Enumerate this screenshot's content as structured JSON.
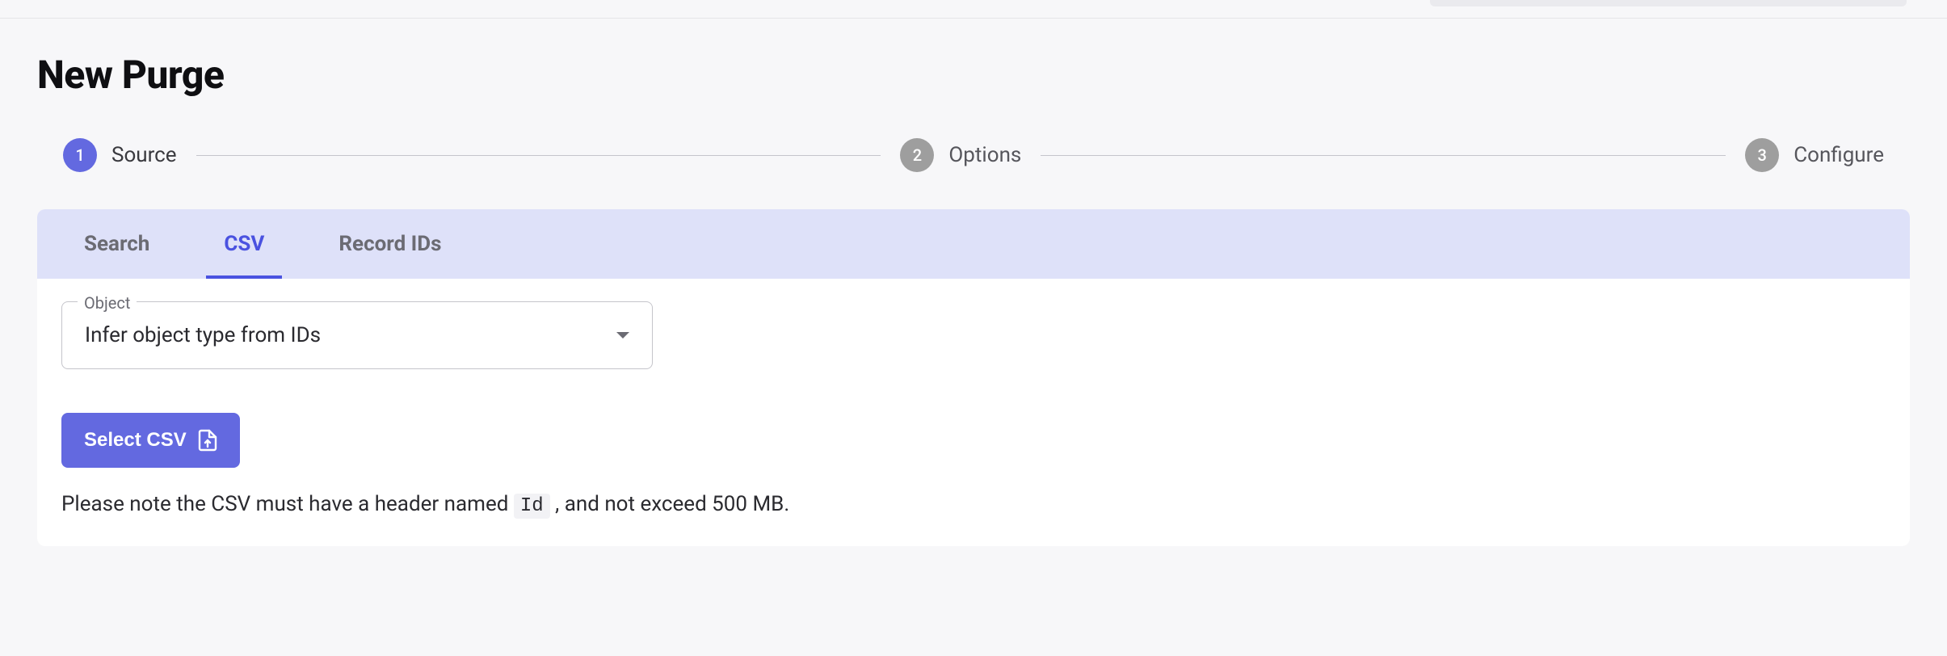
{
  "page": {
    "title": "New Purge"
  },
  "stepper": {
    "steps": [
      {
        "num": "1",
        "label": "Source",
        "active": true
      },
      {
        "num": "2",
        "label": "Options",
        "active": false
      },
      {
        "num": "3",
        "label": "Configure",
        "active": false
      }
    ]
  },
  "tabs": [
    {
      "label": "Search",
      "active": false
    },
    {
      "label": "CSV",
      "active": true
    },
    {
      "label": "Record IDs",
      "active": false
    }
  ],
  "object_select": {
    "label": "Object",
    "value": "Infer object type from IDs"
  },
  "select_csv_button": {
    "label": "Select CSV"
  },
  "helper": {
    "prefix": "Please note the CSV must have a header named ",
    "code": "Id",
    "suffix": " , and not exceed 500 MB."
  }
}
